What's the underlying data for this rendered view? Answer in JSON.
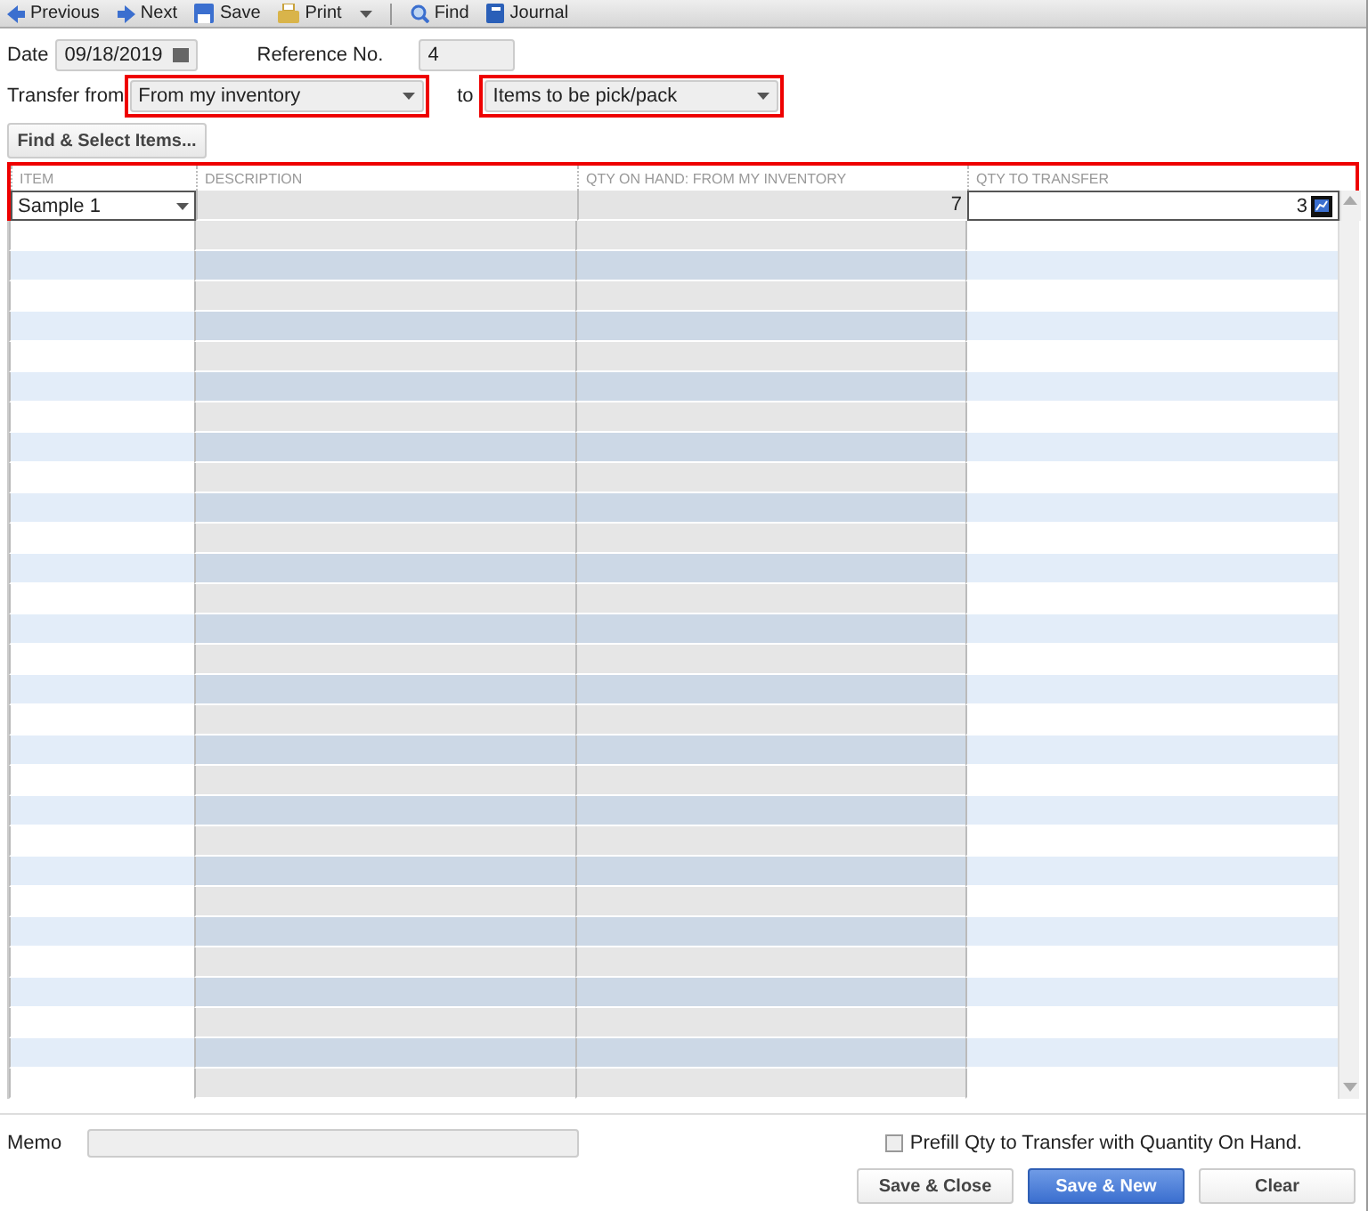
{
  "toolbar": [
    {
      "label": "Previous",
      "kind": "prev"
    },
    {
      "label": "Next",
      "kind": "next"
    },
    {
      "label": "Save",
      "kind": "save"
    },
    {
      "label": "Print",
      "kind": "print"
    },
    {
      "label": "Find",
      "kind": "find"
    },
    {
      "label": "Journal",
      "kind": "journal"
    }
  ],
  "date": {
    "label": "Date",
    "value": "09/18/2019"
  },
  "reference": {
    "label": "Reference No.",
    "value": "4"
  },
  "transfer_from": {
    "label": "Transfer from",
    "value": "From my inventory"
  },
  "transfer_to": {
    "label": "to",
    "value": "Items to be pick/pack"
  },
  "find_button": "Find & Select Items...",
  "table": {
    "columns": [
      "ITEM",
      "DESCRIPTION",
      "QTY ON HAND: FROM MY INVENTORY",
      "QTY TO TRANSFER"
    ],
    "rows": [
      {
        "item": "Sample 1",
        "description": "",
        "on_hand": "7",
        "transfer": "3"
      }
    ]
  },
  "memo": {
    "label": "Memo"
  },
  "prefill": {
    "label": "Prefill Qty to Transfer with Quantity On Hand.",
    "checked": false
  },
  "buttons": [
    {
      "label": "Save & Close",
      "kind": "secondary"
    },
    {
      "label": "Save & New",
      "kind": "primary"
    },
    {
      "label": "Clear",
      "kind": "secondary"
    }
  ]
}
